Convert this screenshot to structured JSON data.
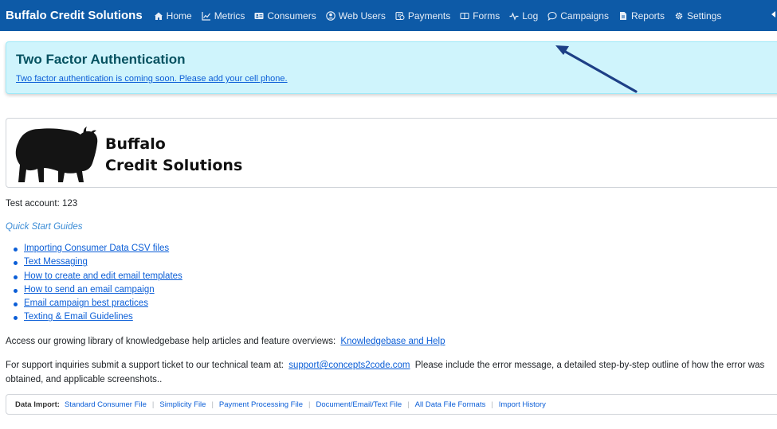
{
  "navbar": {
    "brand": "Buffalo Credit Solutions",
    "items": [
      {
        "label": "Home",
        "icon": "home-icon"
      },
      {
        "label": "Metrics",
        "icon": "line-chart-icon"
      },
      {
        "label": "Consumers",
        "icon": "id-card-icon"
      },
      {
        "label": "Web Users",
        "icon": "user-circle-icon"
      },
      {
        "label": "Payments",
        "icon": "payments-icon"
      },
      {
        "label": "Forms",
        "icon": "forms-icon"
      },
      {
        "label": "Log",
        "icon": "activity-icon"
      },
      {
        "label": "Campaigns",
        "icon": "chat-icon"
      },
      {
        "label": "Reports",
        "icon": "report-file-icon"
      },
      {
        "label": "Settings",
        "icon": "gear-icon"
      }
    ],
    "background": "#0d5aa7"
  },
  "alert": {
    "title": "Two Factor Authentication",
    "message": "Two factor authentication is coming soon. Please add your cell phone."
  },
  "logo": {
    "line1": "Buffalo",
    "line2": "Credit Solutions"
  },
  "account": {
    "text": "Test account: 123"
  },
  "quick_start": {
    "title": "Quick Start Guides",
    "guides": [
      "Importing Consumer Data CSV files",
      "Text Messaging",
      "How to create and edit email templates",
      "How to send an email campaign",
      "Email campaign best practices",
      "Texting & Email Guidelines"
    ]
  },
  "knowledgebase": {
    "text": "Access our growing library of knowledgebase help articles and feature overviews:",
    "link": "Knowledgebase and Help"
  },
  "support": {
    "text_before": "For support inquiries submit a support ticket to our technical team at:",
    "email": "support@concepts2code.com",
    "text_after": "Please include the error message, a detailed step-by-step outline of how the error was obtained, and applicable screenshots.."
  },
  "data_import": {
    "label": "Data Import:",
    "links": [
      "Standard Consumer File",
      "Simplicity File",
      "Payment Processing File",
      "Document/Email/Text File",
      "All Data File Formats",
      "Import History"
    ]
  },
  "colors": {
    "accent": "#0b5ed7",
    "alert_bg": "#cff4fc",
    "arrow": "#1d3f86"
  }
}
